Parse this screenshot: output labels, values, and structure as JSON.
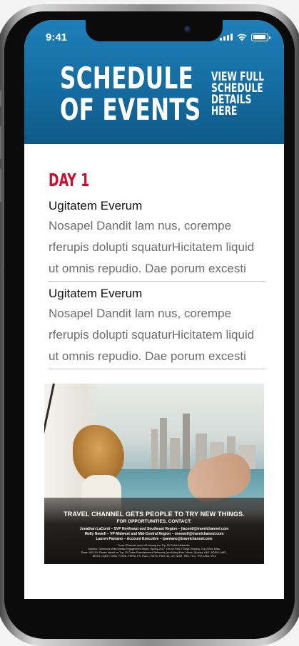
{
  "status_bar": {
    "time": "9:41"
  },
  "header": {
    "title_line1": "SCHEDULE",
    "title_line2": "OF EVENTS",
    "link_lines": [
      "VIEW FULL",
      "SCHEDULE",
      "DETAILS",
      "HERE"
    ]
  },
  "day_label": "DAY 1",
  "events": [
    {
      "title": "Ugitatem Everum",
      "lines": [
        "Nosapel Dandit lam nus, corempe",
        "rferupis dolupti squaturHicitatem liquid",
        "ut omnis repudio. Dae porum excesti"
      ]
    },
    {
      "title": "Ugitatem Everum",
      "lines": [
        "Nosapel Dandit lam nus, corempe",
        "rferupis dolupti squaturHicitatem liquid",
        "ut omnis repudio. Dae porum excesti"
      ]
    }
  ],
  "ad": {
    "headline": "TRAVEL CHANNEL GETS PEOPLE TO TRY NEW THINGS.",
    "sub": "FOR OPPORTUNITIES, CONTACT:",
    "contacts": [
      "Jonathan LaConti – SVP Northeast and Southeast Region – jlaconti@travelchannel.com",
      "Molly Newell – VP Midwest and Mid-Central Region – mnewell@travelchannel.com",
      "Lauren Pantano – Account Executive – lpantano@travelchannel.com"
    ],
    "fine_print": [
      "Travel Channel ranks #3 among the Top 20 Cable Networks.",
      "Scarbor. Simmons Multi-Media Engagement Study: Spring 2017. On-Air Past 7 Days Viewing. Top 2 Box Data.",
      "Base: A25-54. Ranks based on Top 20 Cable Entertainment Networks (excluding Kids, News, Sports): A&E, ADSM, AMC,",
      "BRVO, CMDY, DISC, FOOD, FRFM, FX, HALL, HGTV, HIST, ID, LIF, NGM, TBS, TLC, TNT, USA, VH1"
    ]
  }
}
